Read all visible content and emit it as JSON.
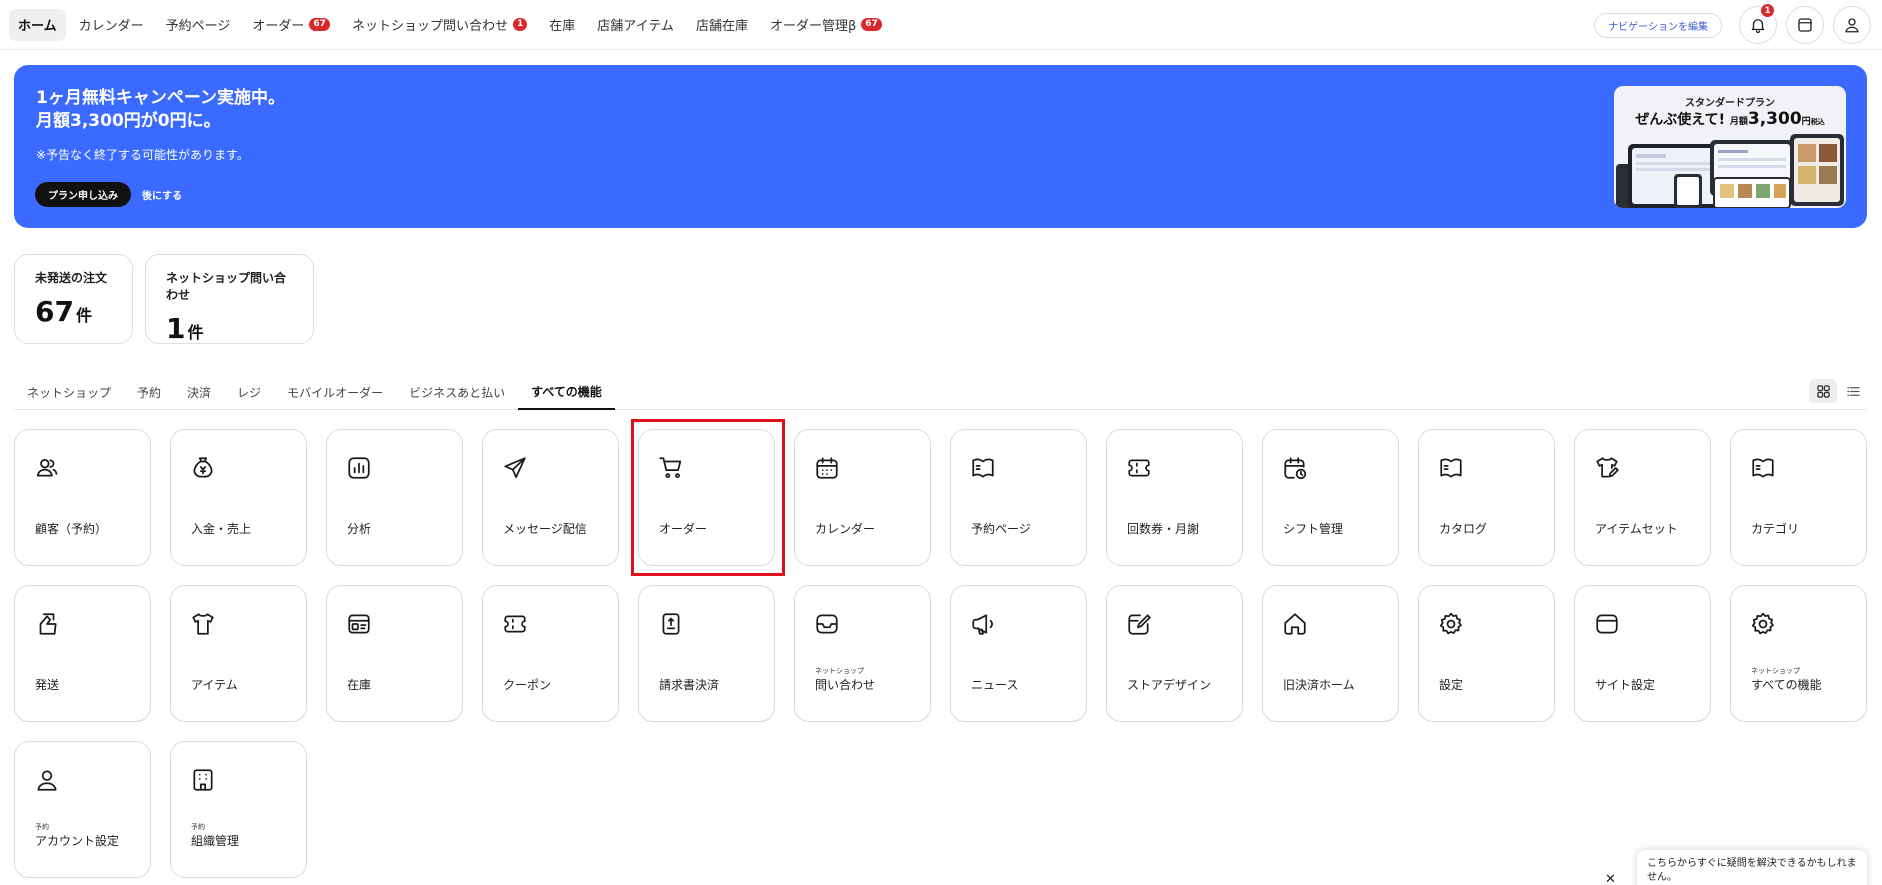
{
  "nav": {
    "items": [
      {
        "label": "ホーム",
        "active": true
      },
      {
        "label": "カレンダー"
      },
      {
        "label": "予約ページ"
      },
      {
        "label": "オーダー",
        "badge": "67"
      },
      {
        "label": "ネットショップ問い合わせ",
        "badge": "1"
      },
      {
        "label": "在庫"
      },
      {
        "label": "店舗アイテム"
      },
      {
        "label": "店舗在庫"
      },
      {
        "label": "オーダー管理β",
        "badge": "67"
      }
    ],
    "edit_label": "ナビゲーションを編集",
    "notification_count": "1"
  },
  "banner": {
    "title_line1": "1ヶ月無料キャンペーン実施中。",
    "title_line2": "月額3,300円が0円に。",
    "note": "※予告なく終了する可能性があります。",
    "apply_label": "プラン申し込み",
    "later_label": "後にする",
    "plan_name": "スタンダードプラン",
    "plan_tagline": "ぜんぶ使えて!",
    "plan_monthly": "月額",
    "plan_price": "3,300",
    "plan_yen": "円",
    "plan_tax": "税込",
    "bg_color": "#3a6aff"
  },
  "stats": [
    {
      "label": "未発送の注文",
      "value": "67",
      "unit": "件"
    },
    {
      "label": "ネットショップ問い合わせ",
      "value": "1",
      "unit": "件"
    }
  ],
  "tabs": [
    {
      "label": "ネットショップ"
    },
    {
      "label": "予約"
    },
    {
      "label": "決済"
    },
    {
      "label": "レジ"
    },
    {
      "label": "モバイルオーダー"
    },
    {
      "label": "ビジネスあと払い"
    },
    {
      "label": "すべての機能",
      "active": true
    }
  ],
  "tiles": [
    {
      "label": "顧客（予約）",
      "icon": "users-icon"
    },
    {
      "label": "入金・売上",
      "icon": "money-bag-icon"
    },
    {
      "label": "分析",
      "icon": "chart-icon"
    },
    {
      "label": "メッセージ配信",
      "icon": "send-icon"
    },
    {
      "label": "オーダー",
      "icon": "cart-icon"
    },
    {
      "label": "カレンダー",
      "icon": "calendar-icon"
    },
    {
      "label": "予約ページ",
      "icon": "book-icon"
    },
    {
      "label": "回数券・月謝",
      "icon": "ticket-icon"
    },
    {
      "label": "シフト管理",
      "icon": "calendar-clock-icon"
    },
    {
      "label": "カタログ",
      "icon": "book-icon"
    },
    {
      "label": "アイテムセット",
      "icon": "shirt-edit-icon"
    },
    {
      "label": "カテゴリ",
      "icon": "book-icon"
    },
    {
      "label": "発送",
      "icon": "hand-box-icon"
    },
    {
      "label": "アイテム",
      "icon": "shirt-icon"
    },
    {
      "label": "在庫",
      "icon": "inventory-icon"
    },
    {
      "label": "クーポン",
      "icon": "ticket-icon"
    },
    {
      "label": "請求書決済",
      "icon": "invoice-icon"
    },
    {
      "label": "問い合わせ",
      "sub": "ネットショップ",
      "icon": "inbox-icon"
    },
    {
      "label": "ニュース",
      "icon": "megaphone-icon"
    },
    {
      "label": "ストアデザイン",
      "icon": "design-icon"
    },
    {
      "label": "旧決済ホーム",
      "icon": "home-icon"
    },
    {
      "label": "設定",
      "icon": "gear-icon"
    },
    {
      "label": "サイト設定",
      "icon": "browser-icon"
    },
    {
      "label": "すべての機能",
      "sub": "ネットショップ",
      "icon": "gear-icon"
    },
    {
      "label": "アカウント設定",
      "sub": "予約",
      "icon": "person-icon"
    },
    {
      "label": "組織管理",
      "sub": "予約",
      "icon": "building-icon"
    }
  ],
  "help": {
    "text": "こちらからすぐに疑問を解決できるかもしれません。"
  }
}
